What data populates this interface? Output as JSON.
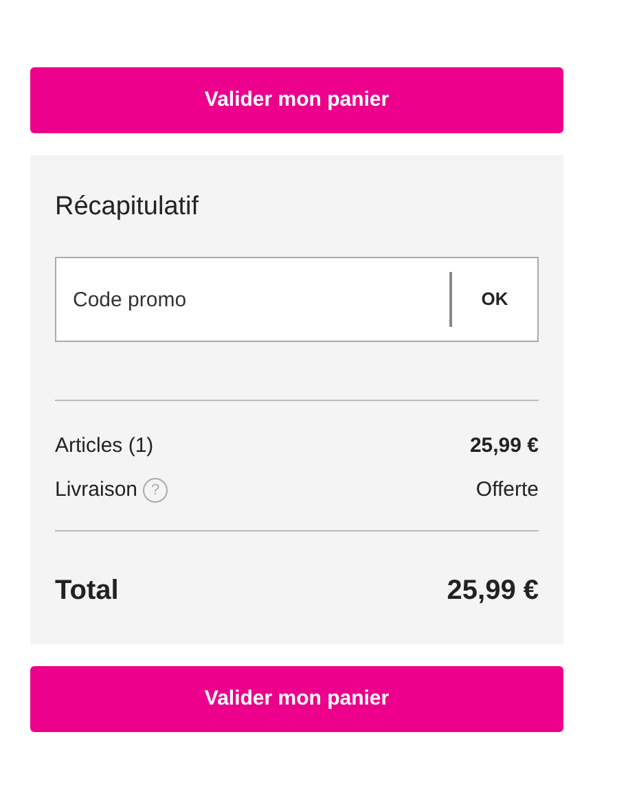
{
  "buttons_top": {
    "label": "Valider mon panier"
  },
  "summary": {
    "title": "Récapitulatif",
    "promo": {
      "placeholder": "Code promo",
      "button": "OK"
    },
    "lines": [
      {
        "kind": "plain",
        "label": "Articles (1)",
        "value": "25,99 €",
        "bold_value": true
      },
      {
        "kind": "help",
        "label": "Livraison",
        "help": "?",
        "value": "Offerte",
        "bold_value": false
      }
    ],
    "total": {
      "label": "Total",
      "value": "25,99 €"
    }
  },
  "buttons_bottom": {
    "label": "Valider mon panier"
  }
}
